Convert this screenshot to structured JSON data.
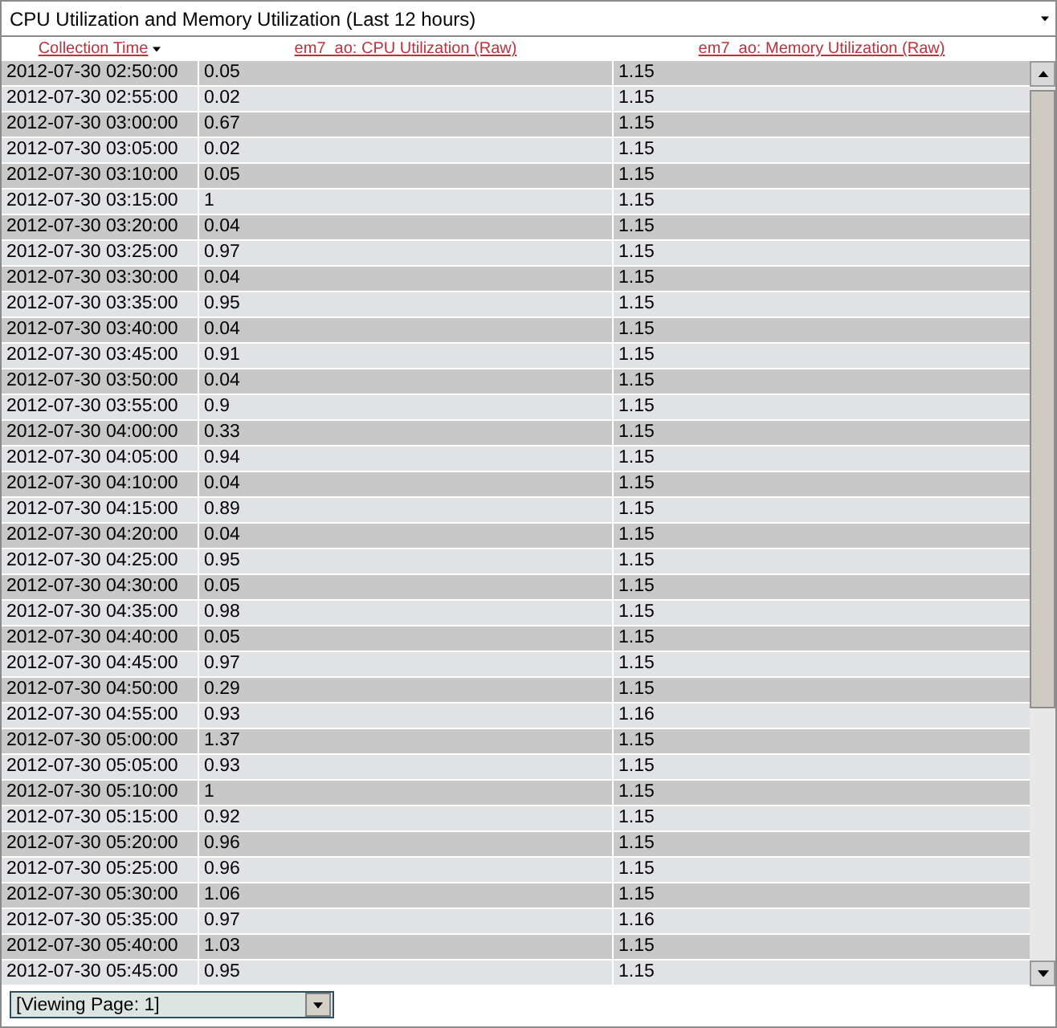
{
  "report_select": {
    "value": "CPU Utilization and Memory Utilization (Last 12 hours)"
  },
  "table": {
    "columns": [
      {
        "label": "Collection Time",
        "sorted": true
      },
      {
        "label": "em7_ao: CPU Utilization (Raw)",
        "sorted": false
      },
      {
        "label": "em7_ao: Memory Utilization (Raw)",
        "sorted": false
      }
    ],
    "rows": [
      [
        "2012-07-30 02:50:00",
        "0.05",
        "1.15"
      ],
      [
        "2012-07-30 02:55:00",
        "0.02",
        "1.15"
      ],
      [
        "2012-07-30 03:00:00",
        "0.67",
        "1.15"
      ],
      [
        "2012-07-30 03:05:00",
        "0.02",
        "1.15"
      ],
      [
        "2012-07-30 03:10:00",
        "0.05",
        "1.15"
      ],
      [
        "2012-07-30 03:15:00",
        "1",
        "1.15"
      ],
      [
        "2012-07-30 03:20:00",
        "0.04",
        "1.15"
      ],
      [
        "2012-07-30 03:25:00",
        "0.97",
        "1.15"
      ],
      [
        "2012-07-30 03:30:00",
        "0.04",
        "1.15"
      ],
      [
        "2012-07-30 03:35:00",
        "0.95",
        "1.15"
      ],
      [
        "2012-07-30 03:40:00",
        "0.04",
        "1.15"
      ],
      [
        "2012-07-30 03:45:00",
        "0.91",
        "1.15"
      ],
      [
        "2012-07-30 03:50:00",
        "0.04",
        "1.15"
      ],
      [
        "2012-07-30 03:55:00",
        "0.9",
        "1.15"
      ],
      [
        "2012-07-30 04:00:00",
        "0.33",
        "1.15"
      ],
      [
        "2012-07-30 04:05:00",
        "0.94",
        "1.15"
      ],
      [
        "2012-07-30 04:10:00",
        "0.04",
        "1.15"
      ],
      [
        "2012-07-30 04:15:00",
        "0.89",
        "1.15"
      ],
      [
        "2012-07-30 04:20:00",
        "0.04",
        "1.15"
      ],
      [
        "2012-07-30 04:25:00",
        "0.95",
        "1.15"
      ],
      [
        "2012-07-30 04:30:00",
        "0.05",
        "1.15"
      ],
      [
        "2012-07-30 04:35:00",
        "0.98",
        "1.15"
      ],
      [
        "2012-07-30 04:40:00",
        "0.05",
        "1.15"
      ],
      [
        "2012-07-30 04:45:00",
        "0.97",
        "1.15"
      ],
      [
        "2012-07-30 04:50:00",
        "0.29",
        "1.15"
      ],
      [
        "2012-07-30 04:55:00",
        "0.93",
        "1.16"
      ],
      [
        "2012-07-30 05:00:00",
        "1.37",
        "1.15"
      ],
      [
        "2012-07-30 05:05:00",
        "0.93",
        "1.15"
      ],
      [
        "2012-07-30 05:10:00",
        "1",
        "1.15"
      ],
      [
        "2012-07-30 05:15:00",
        "0.92",
        "1.15"
      ],
      [
        "2012-07-30 05:20:00",
        "0.96",
        "1.15"
      ],
      [
        "2012-07-30 05:25:00",
        "0.96",
        "1.15"
      ],
      [
        "2012-07-30 05:30:00",
        "1.06",
        "1.15"
      ],
      [
        "2012-07-30 05:35:00",
        "0.97",
        "1.16"
      ],
      [
        "2012-07-30 05:40:00",
        "1.03",
        "1.15"
      ],
      [
        "2012-07-30 05:45:00",
        "0.95",
        "1.15"
      ]
    ]
  },
  "pager": {
    "value": "[Viewing Page: 1]"
  }
}
